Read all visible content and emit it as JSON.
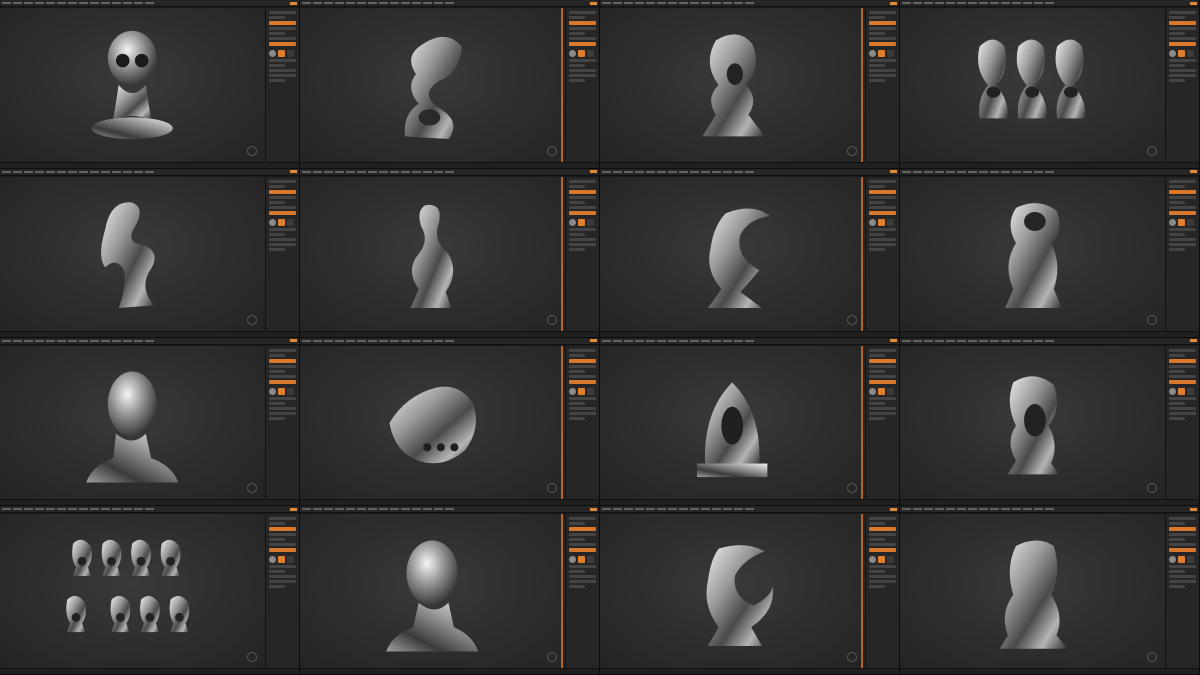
{
  "app": {
    "accent_color": "#e0802f",
    "viewport_color": "#2f2f2f",
    "metal_light": "#f0f0f0",
    "metal_dark": "#2b2b2b"
  },
  "panels": [
    {
      "id": 1,
      "subject": "skull-on-stand-sculpt",
      "viewport_tag": "",
      "sidebar_side": "right"
    },
    {
      "id": 2,
      "subject": "twisted-loop-sculpt",
      "viewport_tag": "",
      "sidebar_side": "right"
    },
    {
      "id": 3,
      "subject": "rock-formation-sculpt",
      "viewport_tag": "",
      "sidebar_side": "right"
    },
    {
      "id": 4,
      "subject": "three-abstract-sculpts",
      "viewport_tag": "",
      "sidebar_side": "right"
    },
    {
      "id": 5,
      "subject": "melting-stem-sculpt",
      "viewport_tag": "",
      "sidebar_side": "right"
    },
    {
      "id": 6,
      "subject": "flowing-tower-sculpt",
      "viewport_tag": "",
      "sidebar_side": "right"
    },
    {
      "id": 7,
      "subject": "crescent-wave-sculpt",
      "viewport_tag": "",
      "sidebar_side": "right"
    },
    {
      "id": 8,
      "subject": "hooded-figure-sculpt",
      "viewport_tag": "",
      "sidebar_side": "right"
    },
    {
      "id": 9,
      "subject": "female-head-bust",
      "viewport_tag": "",
      "sidebar_side": "right"
    },
    {
      "id": 10,
      "subject": "bone-ribbed-sculpt",
      "viewport_tag": "",
      "sidebar_side": "right"
    },
    {
      "id": 11,
      "subject": "ornate-arch-sculpt",
      "viewport_tag": "",
      "sidebar_side": "right"
    },
    {
      "id": 12,
      "subject": "hollow-totem-sculpt",
      "viewport_tag": "",
      "sidebar_side": "right"
    },
    {
      "id": 13,
      "subject": "sculpt-variations-array",
      "viewport_tag": "",
      "sidebar_side": "right"
    },
    {
      "id": 14,
      "subject": "female-head-bust-side",
      "viewport_tag": "",
      "sidebar_side": "right"
    },
    {
      "id": 15,
      "subject": "horned-crescent-sculpt",
      "viewport_tag": "",
      "sidebar_side": "right"
    },
    {
      "id": 16,
      "subject": "draped-column-sculpt",
      "viewport_tag": "",
      "sidebar_side": "right"
    }
  ]
}
